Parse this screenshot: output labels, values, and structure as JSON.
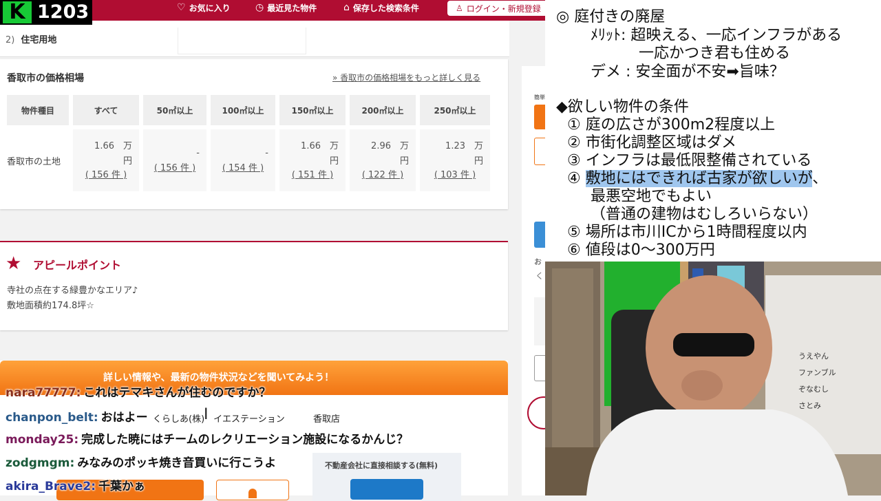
{
  "stream": {
    "logo_letter": "K",
    "viewer_count": "1203"
  },
  "nav": {
    "favorites": "お気に入り",
    "recent": "最近見た物件",
    "saved_search": "保存した検索条件",
    "login": "ログイン・新規登録"
  },
  "property": {
    "land_type": "住宅用地"
  },
  "price_table": {
    "title": "香取市の価格相場",
    "more_link": "» 香取市の価格相場をもっと詳しく見る",
    "headers": [
      "物件種目",
      "すべて",
      "50㎡以上",
      "100㎡以上",
      "150㎡以上",
      "200㎡以上",
      "250㎡以上"
    ],
    "row_label": "香取市の土地",
    "cells": [
      {
        "value": "1.66　万\n円",
        "count": "( 156 件 )"
      },
      {
        "value": "-",
        "count": "( 156 件 )"
      },
      {
        "value": "-",
        "count": "( 154 件 )"
      },
      {
        "value": "1.66　万\n円",
        "count": "( 151 件 )"
      },
      {
        "value": "2.96　万\n円",
        "count": "( 122 件 )"
      },
      {
        "value": "1.23　万\n円",
        "count": "( 103 件 )"
      }
    ]
  },
  "appeal": {
    "title": "アピールポイント",
    "line1": "寺社の点在する緑豊かなエリア♪",
    "line2": "敷地面積約174.8坪☆"
  },
  "contact": {
    "banner": "詳しい情報や、最新の物件状況などを聞いてみよう！",
    "company": "くらしあ(株)　イエステーション",
    "branch": "香取店",
    "direct": "不動産会社に直接相談する(無料)"
  },
  "whiteboard": {
    "l1": "◎ 庭付きの廃屋",
    "l2": "ﾒﾘｯﾄ: 超映える、一応インフラがある",
    "l3": "一応かつき君も住める",
    "l4": "デメ : 安全面が不安➡旨味？",
    "l5": "◆欲しい物件の条件",
    "l6": "① 庭の広さが300m2程度以上",
    "l7": "② 市街化調整区域はダメ",
    "l8": "③ インフラは最低限整備されている",
    "l9_marker": "④ ",
    "l9_highlight": "敷地にはできれば古家が欲しいが",
    "l9_tail": "、",
    "l10": "最悪空地でもよい",
    "l11": "（普通の建物はむしろいらない）",
    "l12": "⑤ 場所は市川ICから1時間程度以内",
    "l13": "⑥ 値段は0～300万円"
  },
  "webcam": {
    "names": [
      "うえやん",
      "ファンブル",
      "ぞなむし",
      "さとみ"
    ]
  },
  "chat": [
    {
      "user": "nara77777:",
      "text": "これはテマキさんが住むのですか？",
      "color": "#8a2e1a"
    },
    {
      "user": "chanpon_belt:",
      "text": "おはよー",
      "color": "#2a5a8a"
    },
    {
      "user": "monday25:",
      "text": "完成した暁にはチームのレクリエーション施設になるかんじ？",
      "color": "#7a1a5a"
    },
    {
      "user": "zodgmgm:",
      "text": "みなみのポッキ焼き音買いに行こうよ",
      "color": "#1a5a3a"
    },
    {
      "user": "akira_Brave2:",
      "text": "千葉かぁ",
      "color": "#2a3a9a"
    }
  ],
  "colors": {
    "brand": "#b00d32",
    "accent_orange": "#f17414",
    "highlight": "#9fc6ee"
  }
}
